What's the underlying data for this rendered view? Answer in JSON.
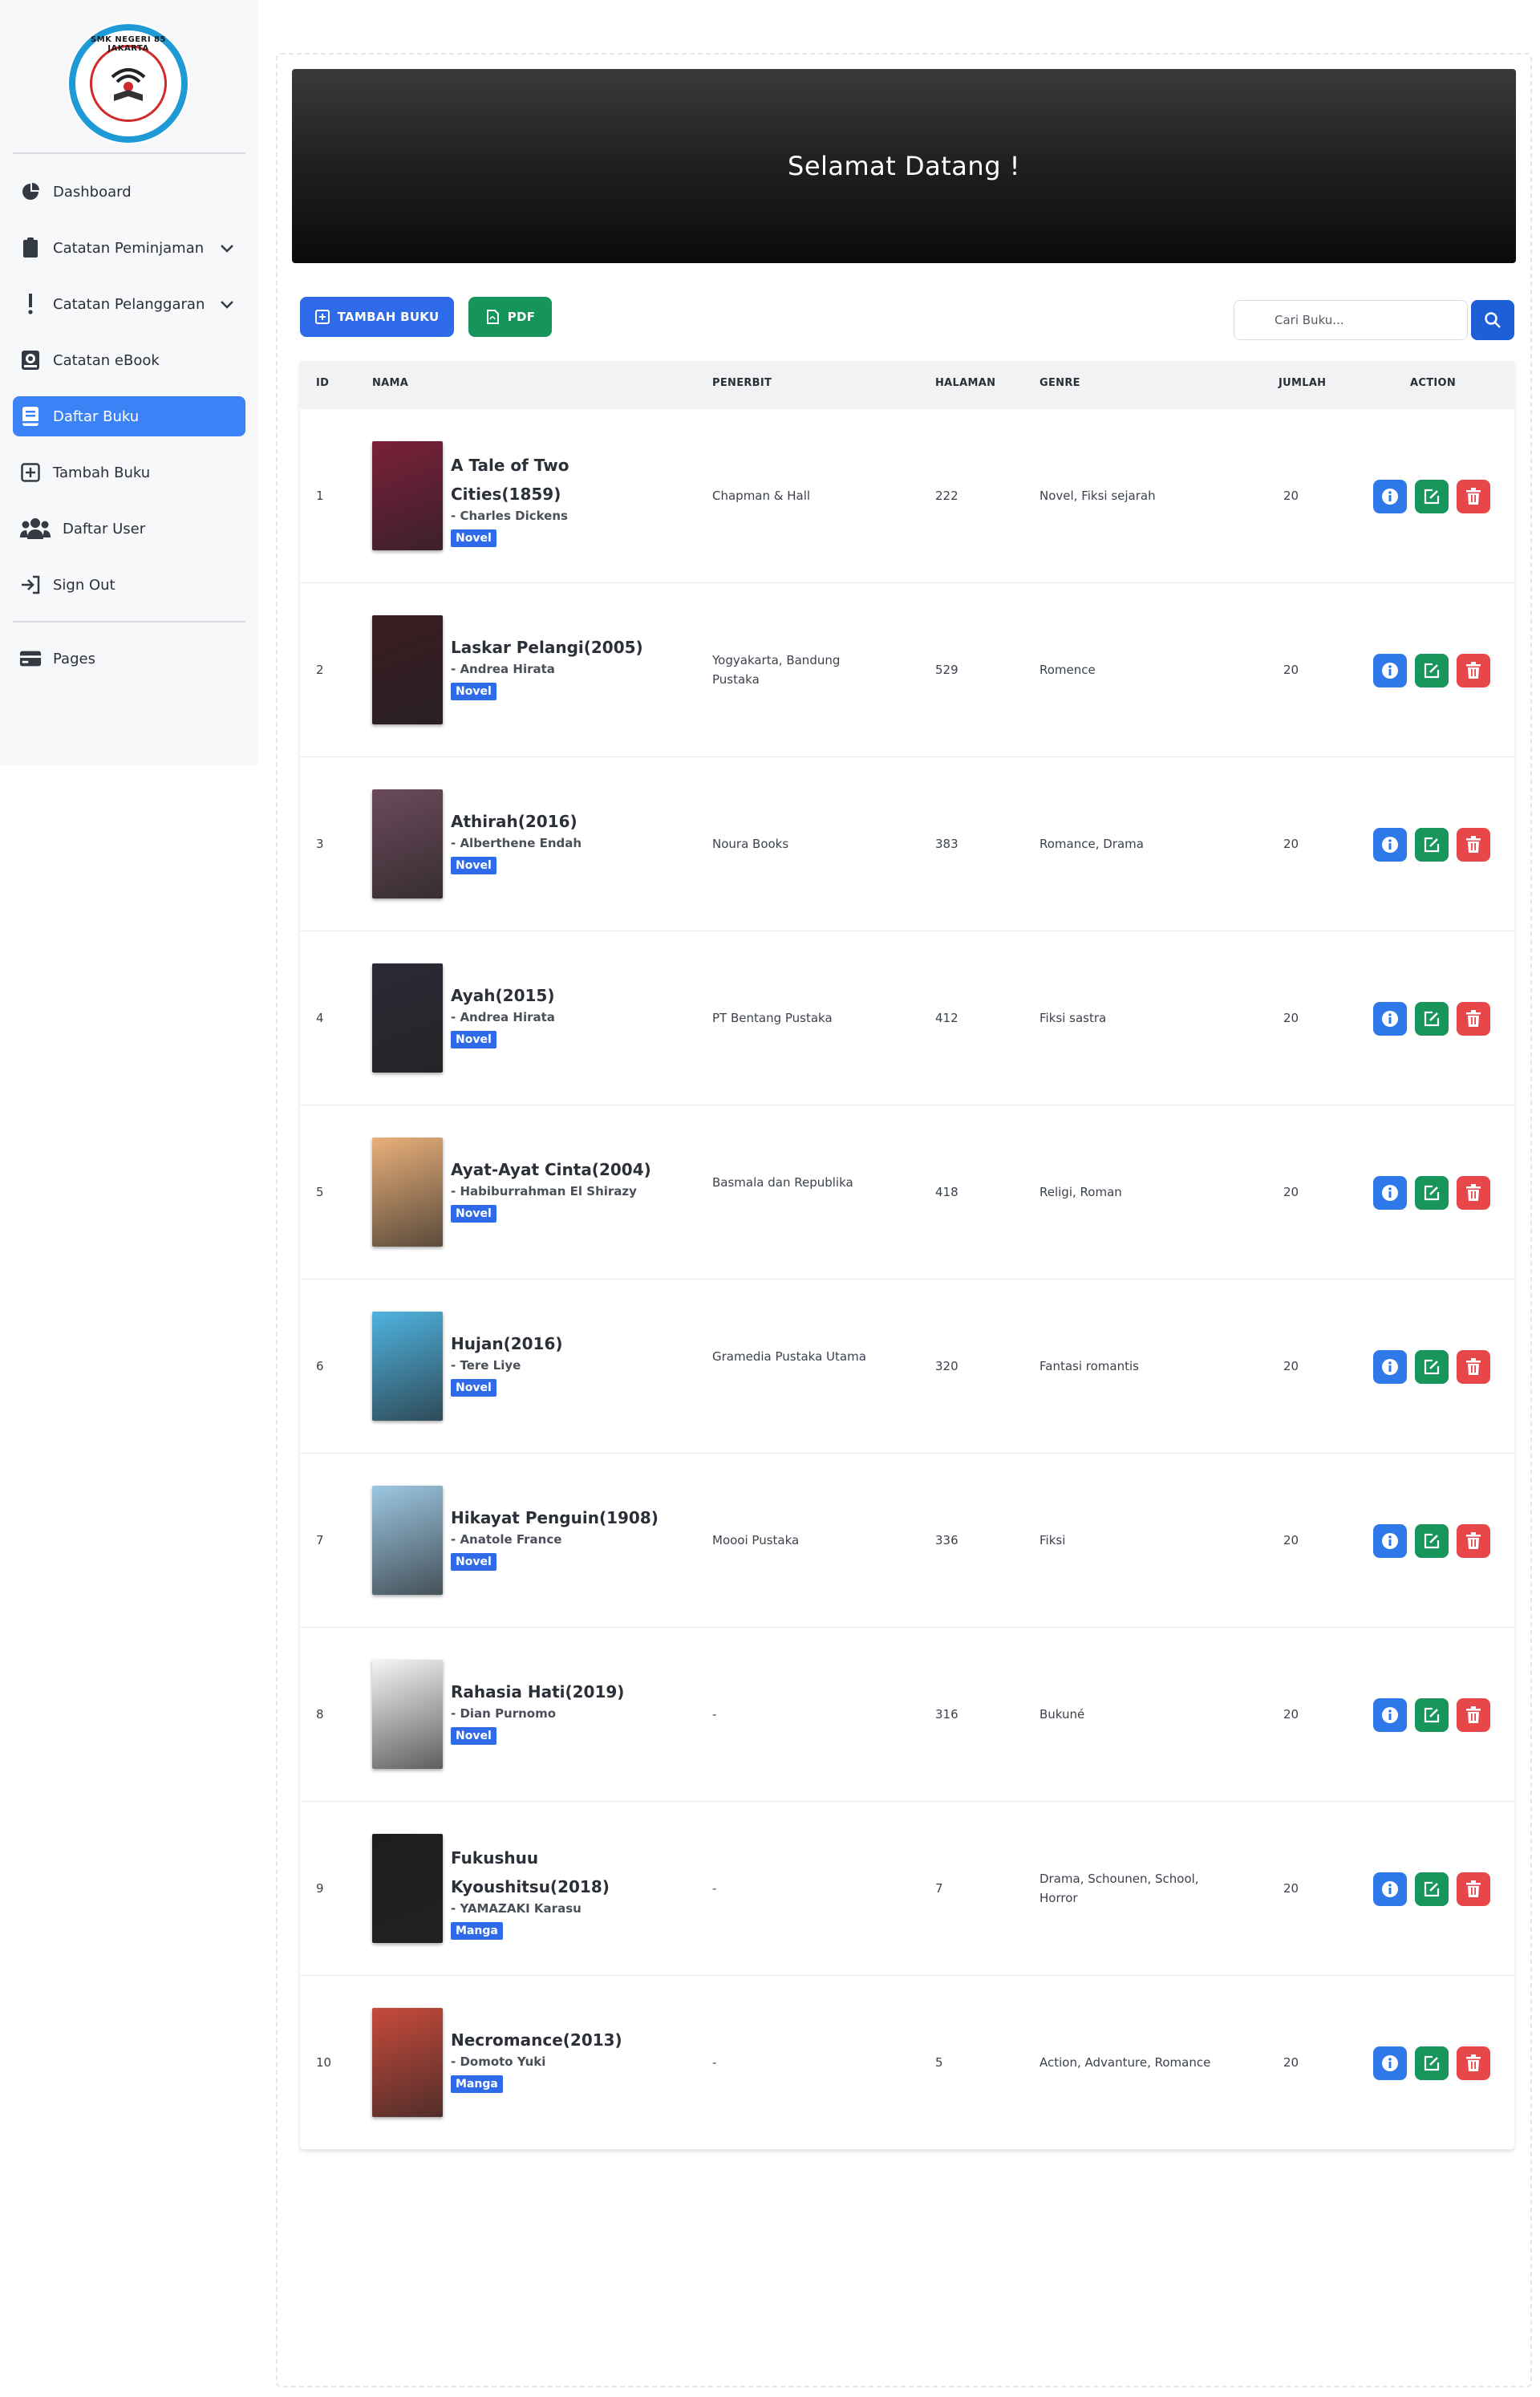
{
  "sidebar": {
    "logo_text": "SMK NEGERI 85 JAKARTA",
    "items": [
      {
        "label": "Dashboard",
        "icon": "pie-chart-icon"
      },
      {
        "label": "Catatan Peminjaman",
        "icon": "clipboard-icon"
      },
      {
        "label": "Catatan Pelanggaran",
        "icon": "exclamation-icon"
      },
      {
        "label": "Catatan eBook",
        "icon": "ebook-icon"
      },
      {
        "label": "Daftar Buku",
        "icon": "book-icon"
      },
      {
        "label": "Tambah Buku",
        "icon": "plus-square-icon"
      },
      {
        "label": "Daftar User",
        "icon": "users-icon"
      },
      {
        "label": "Sign Out",
        "icon": "sign-out-icon"
      },
      {
        "label": "Pages",
        "icon": "credit-card-icon"
      }
    ],
    "active_index": 4
  },
  "hero": {
    "title": "Selamat Datang !"
  },
  "toolbar": {
    "add_label": "TAMBAH BUKU",
    "pdf_label": "PDF",
    "search_placeholder": "Cari Buku..."
  },
  "table": {
    "headers": [
      "ID",
      "NAMA",
      "PENERBIT",
      "HALAMAN",
      "GENRE",
      "JUMLAH",
      "ACTION"
    ],
    "rows": [
      {
        "id": "1",
        "title": "A Tale of Two Cities(1859)",
        "author": "- Charles Dickens",
        "tag": "Novel",
        "publisher": "Chapman & Hall",
        "pages": "222",
        "genre": "Novel, Fiksi sejarah",
        "qty": "20",
        "cover": "#7a1f3a"
      },
      {
        "id": "2",
        "title": "Laskar Pelangi(2005)",
        "author": "- Andrea Hirata",
        "tag": "Novel",
        "publisher": "Yogyakarta, Bandung Pustaka",
        "pages": "529",
        "genre": "Romence",
        "qty": "20",
        "cover": "#3a1c22"
      },
      {
        "id": "3",
        "title": "Athirah(2016)",
        "author": "- Alberthene Endah",
        "tag": "Novel",
        "publisher": "Noura Books",
        "pages": "383",
        "genre": "Romance, Drama",
        "qty": "20",
        "cover": "#6b4a5a"
      },
      {
        "id": "4",
        "title": "Ayah(2015)",
        "author": "- Andrea Hirata",
        "tag": "Novel",
        "publisher": "PT Bentang Pustaka",
        "pages": "412",
        "genre": "Fiksi sastra",
        "qty": "20",
        "cover": "#2a2a35"
      },
      {
        "id": "5",
        "title": "Ayat-Ayat Cinta(2004)",
        "author": "- Habiburrahman El Shirazy",
        "tag": "Novel",
        "publisher": "Basmala dan Republika",
        "pages": "418",
        "genre": "Religi, Roman",
        "qty": "20",
        "cover": "#e9b07a"
      },
      {
        "id": "6",
        "title": "Hujan(2016)",
        "author": "- Tere Liye",
        "tag": "Novel",
        "publisher": "Gramedia Pustaka Utama",
        "pages": "320",
        "genre": "Fantasi romantis",
        "qty": "20",
        "cover": "#4fb3e0"
      },
      {
        "id": "7",
        "title": "Hikayat Penguin(1908)",
        "author": "- Anatole France",
        "tag": "Novel",
        "publisher": "Moooi Pustaka",
        "pages": "336",
        "genre": "Fiksi",
        "qty": "20",
        "cover": "#9cc7e2"
      },
      {
        "id": "8",
        "title": "Rahasia Hati(2019)",
        "author": "- Dian Purnomo",
        "tag": "Novel",
        "publisher": "-",
        "pages": "316",
        "genre": "Bukuné",
        "qty": "20",
        "cover": "#f6f6f6"
      },
      {
        "id": "9",
        "title": "Fukushuu Kyoushitsu(2018)",
        "author": "- YAMAZAKI Karasu",
        "tag": "Manga",
        "publisher": "-",
        "pages": "7",
        "genre": "Drama, Schounen, School, Horror",
        "qty": "20",
        "cover": "#1d1d1f"
      },
      {
        "id": "10",
        "title": "Necromance(2013)",
        "author": "- Domoto Yuki",
        "tag": "Manga",
        "publisher": "-",
        "pages": "5",
        "genre": "Action, Advanture, Romance",
        "qty": "20",
        "cover": "#c74a3c"
      }
    ]
  }
}
